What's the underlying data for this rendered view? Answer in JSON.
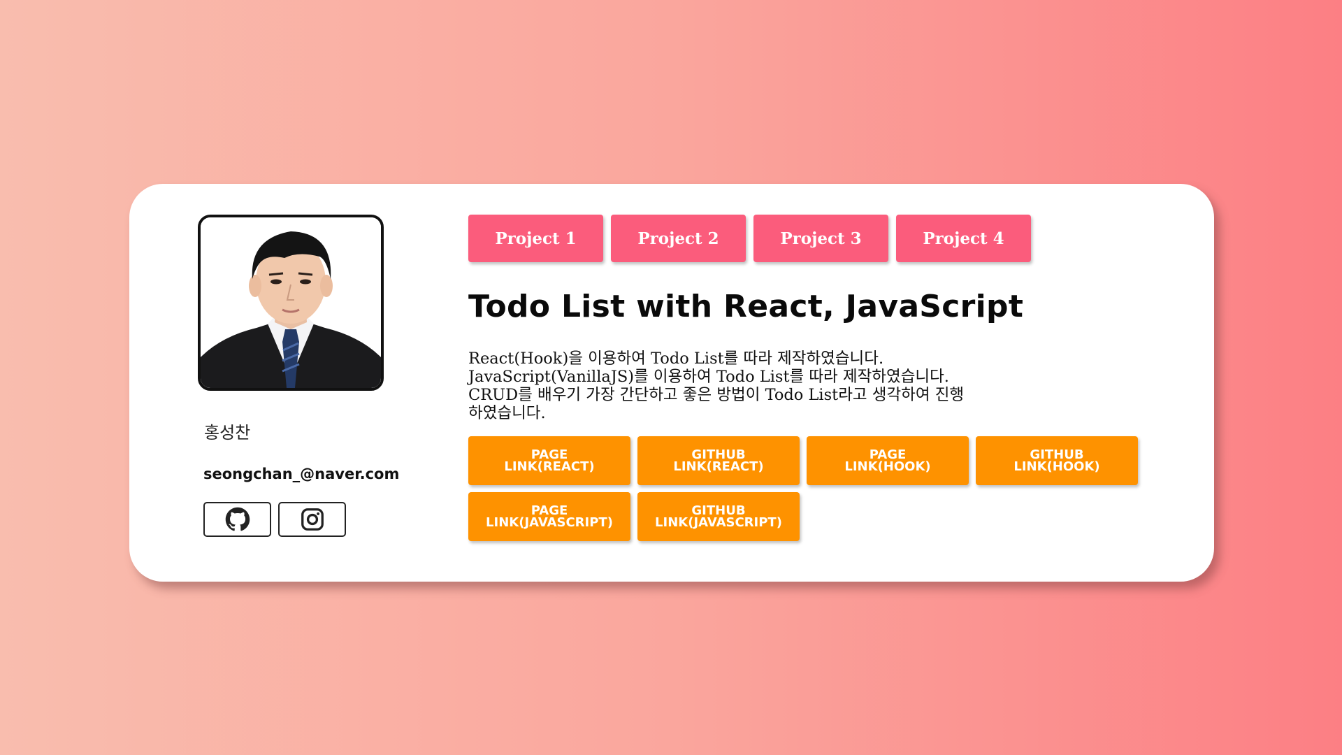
{
  "profile": {
    "name": "홍성찬",
    "email": "seongchan_@naver.com",
    "photo_alt": "",
    "socials": [
      {
        "icon": "github-icon"
      },
      {
        "icon": "instagram-icon"
      }
    ]
  },
  "tabs": [
    {
      "label": "Project 1"
    },
    {
      "label": "Project 2"
    },
    {
      "label": "Project 3"
    },
    {
      "label": "Project 4"
    }
  ],
  "project": {
    "title": "Todo List with React, JavaScript",
    "description": [
      "React(Hook)을 이용하여 Todo List를 따라 제작하였습니다.",
      "JavaScript(VanillaJS)를 이용하여 Todo List를 따라 제작하였습니다.",
      "CRUD를 배우기 가장 간단하고 좋은 방법이 Todo List라고 생각하여 진행",
      "하였습니다."
    ],
    "links": [
      {
        "line1": "PAGE",
        "line2": "LINK(REACT)"
      },
      {
        "line1": "GITHUB",
        "line2": "LINK(REACT)"
      },
      {
        "line1": "PAGE",
        "line2": "LINK(HOOK)"
      },
      {
        "line1": "GITHUB",
        "line2": "LINK(HOOK)"
      },
      {
        "line1": "PAGE",
        "line2": "LINK(JAVASCRIPT)"
      },
      {
        "line1": "GITHUB",
        "line2": "LINK(JAVASCRIPT)"
      }
    ]
  },
  "colors": {
    "tab_accent": "#fb5c7c",
    "link_accent": "#fe9200",
    "background_start": "#f9bdae",
    "background_end": "#fc7f84"
  }
}
